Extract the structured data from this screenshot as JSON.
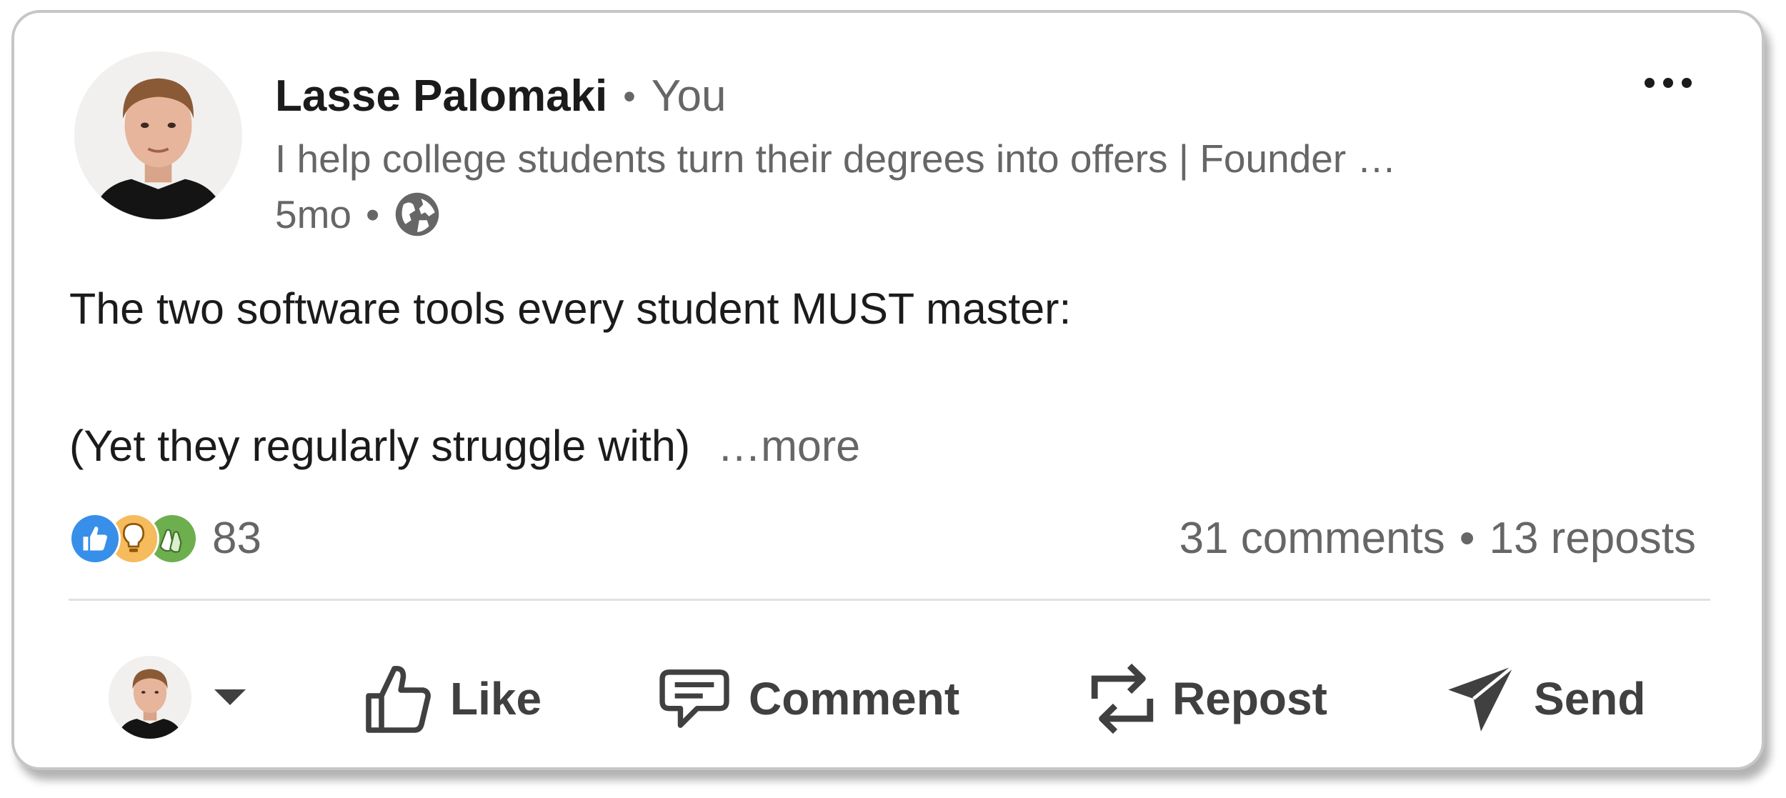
{
  "post": {
    "author": {
      "name": "Lasse Palomaki",
      "relation": "You",
      "headline": "I help college students turn their degrees into offers | Founder …",
      "time": "5mo",
      "visibility_icon": "globe-icon"
    },
    "menu_icon": "more-options-icon",
    "text_line1": "The two software tools every student MUST master:",
    "text_line2": "(Yet they regularly struggle with)",
    "see_more": "…more",
    "reactions": {
      "icons": [
        "like-reaction-icon",
        "insightful-reaction-icon",
        "celebrate-reaction-icon"
      ],
      "count": "83"
    },
    "comments": "31 comments",
    "reposts": "13 reposts",
    "separator": "•"
  },
  "actions": {
    "like": "Like",
    "comment": "Comment",
    "repost": "Repost",
    "send": "Send"
  },
  "colors": {
    "text_primary": "#1b1b1b",
    "text_secondary": "#666666",
    "action_text": "#404040",
    "like_blue": "#378fe9",
    "insightful_yellow": "#f5bb5c",
    "celebrate_green": "#44712e"
  }
}
